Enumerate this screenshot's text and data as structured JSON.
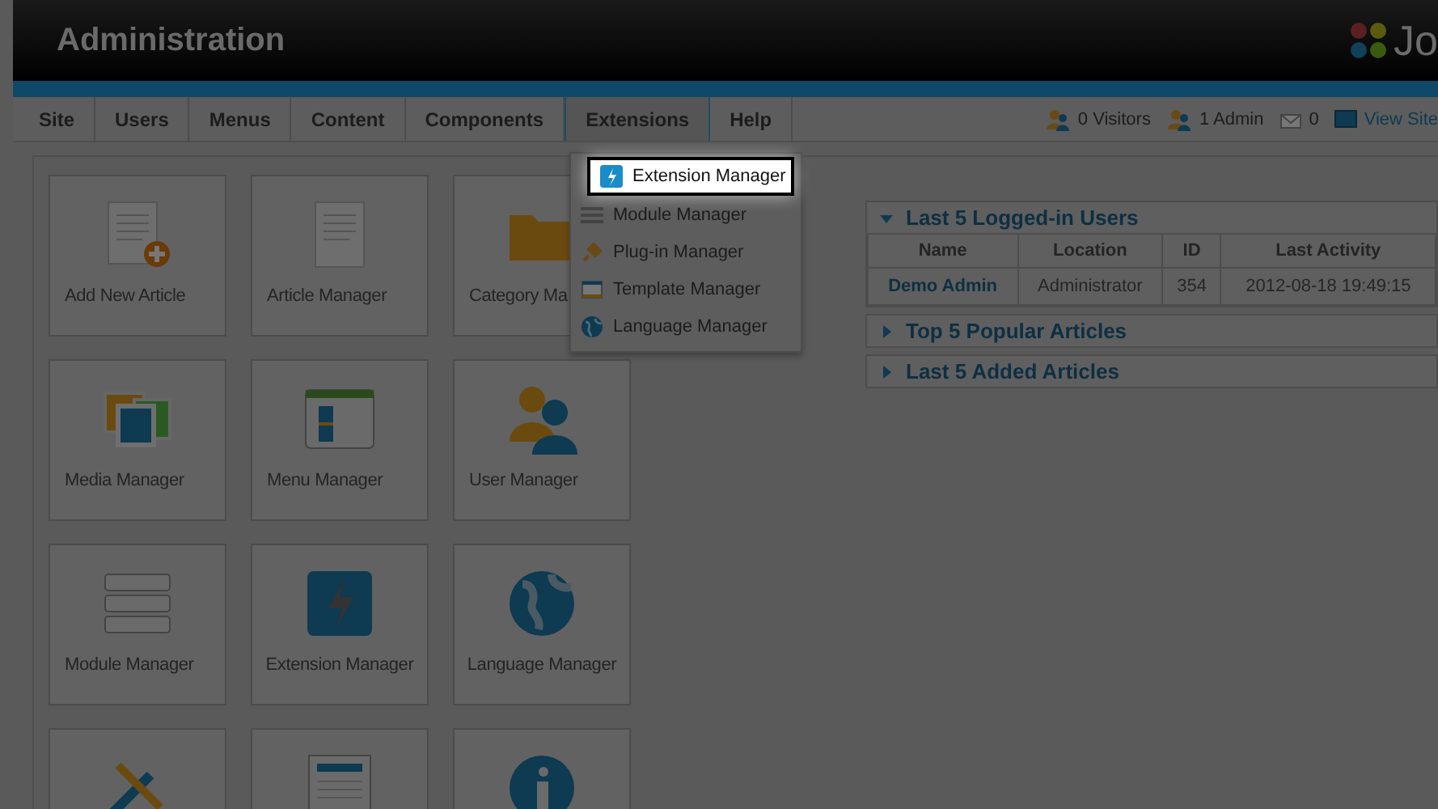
{
  "header": {
    "title": "Administration",
    "logo_text": "Jo"
  },
  "menu": [
    {
      "label": "Site",
      "selected": false
    },
    {
      "label": "Users",
      "selected": false
    },
    {
      "label": "Menus",
      "selected": false
    },
    {
      "label": "Content",
      "selected": false
    },
    {
      "label": "Components",
      "selected": false
    },
    {
      "label": "Extensions",
      "selected": true
    },
    {
      "label": "Help",
      "selected": false
    }
  ],
  "status": [
    {
      "kind": "visitors",
      "text": "0 Visitors"
    },
    {
      "kind": "admins",
      "text": "1 Admin"
    },
    {
      "kind": "messages",
      "text": "0"
    },
    {
      "kind": "site",
      "text": "View Site"
    }
  ],
  "dropdown": [
    {
      "kind": "extension",
      "label": "Extension Manager",
      "selected": true
    },
    {
      "kind": "module",
      "label": "Module Manager",
      "selected": false
    },
    {
      "kind": "plugin",
      "label": "Plug-in Manager",
      "selected": false
    },
    {
      "kind": "template",
      "label": "Template Manager",
      "selected": false
    },
    {
      "kind": "language",
      "label": "Language Manager",
      "selected": false
    }
  ],
  "cards": [
    {
      "kind": "add-article",
      "label": "Add New Article"
    },
    {
      "kind": "article",
      "label": "Article Manager"
    },
    {
      "kind": "category",
      "label": "Category Ma"
    },
    {
      "kind": "media",
      "label": "Media Manager"
    },
    {
      "kind": "menu",
      "label": "Menu Manager"
    },
    {
      "kind": "user",
      "label": "User Manager"
    },
    {
      "kind": "module",
      "label": "Module Manager"
    },
    {
      "kind": "extension",
      "label": "Extension Manager"
    },
    {
      "kind": "language",
      "label": "Language Manager"
    },
    {
      "kind": "tools"
    },
    {
      "kind": "document"
    },
    {
      "kind": "info"
    }
  ],
  "panels": [
    {
      "title": "Last 5 Logged-in Users",
      "expanded": true,
      "table": {
        "columns": [
          "Name",
          "Location",
          "ID",
          "Last Activity"
        ],
        "rows": [
          [
            "Demo Admin",
            "Administrator",
            "354",
            "2012-08-18 19:49:15"
          ]
        ]
      }
    },
    {
      "title": "Top 5 Popular Articles",
      "expanded": false
    },
    {
      "title": "Last 5 Added Articles",
      "expanded": false
    }
  ]
}
